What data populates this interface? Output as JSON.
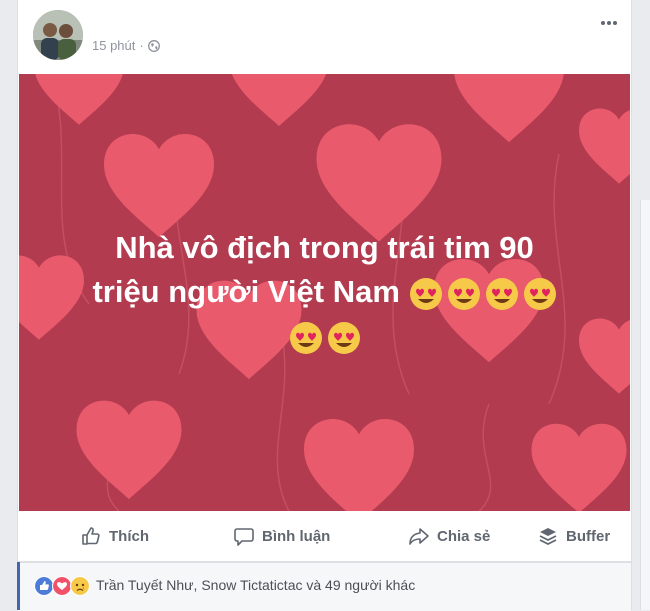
{
  "post": {
    "timestamp": "15 phút",
    "privacy_icon": "globe-icon",
    "more_icon": "more-options-icon",
    "text_line1": "Nhà vô địch trong trái tim 90",
    "text_line2": "triệu người Việt Nam",
    "emoji_icon": "heart-eyes-emoji"
  },
  "actions": {
    "like_label": "Thích",
    "comment_label": "Bình luận",
    "share_label": "Chia sẻ",
    "buffer_label": "Buffer"
  },
  "reactions": {
    "text": "Trần Tuyết Như, Snow Tictatictac và 49 người khác",
    "icons": [
      "like-reaction-icon",
      "love-reaction-icon",
      "sad-reaction-icon"
    ]
  },
  "colors": {
    "background": "#b23b4f",
    "hearts": "#e85a6c",
    "accent": "#4267b2"
  }
}
